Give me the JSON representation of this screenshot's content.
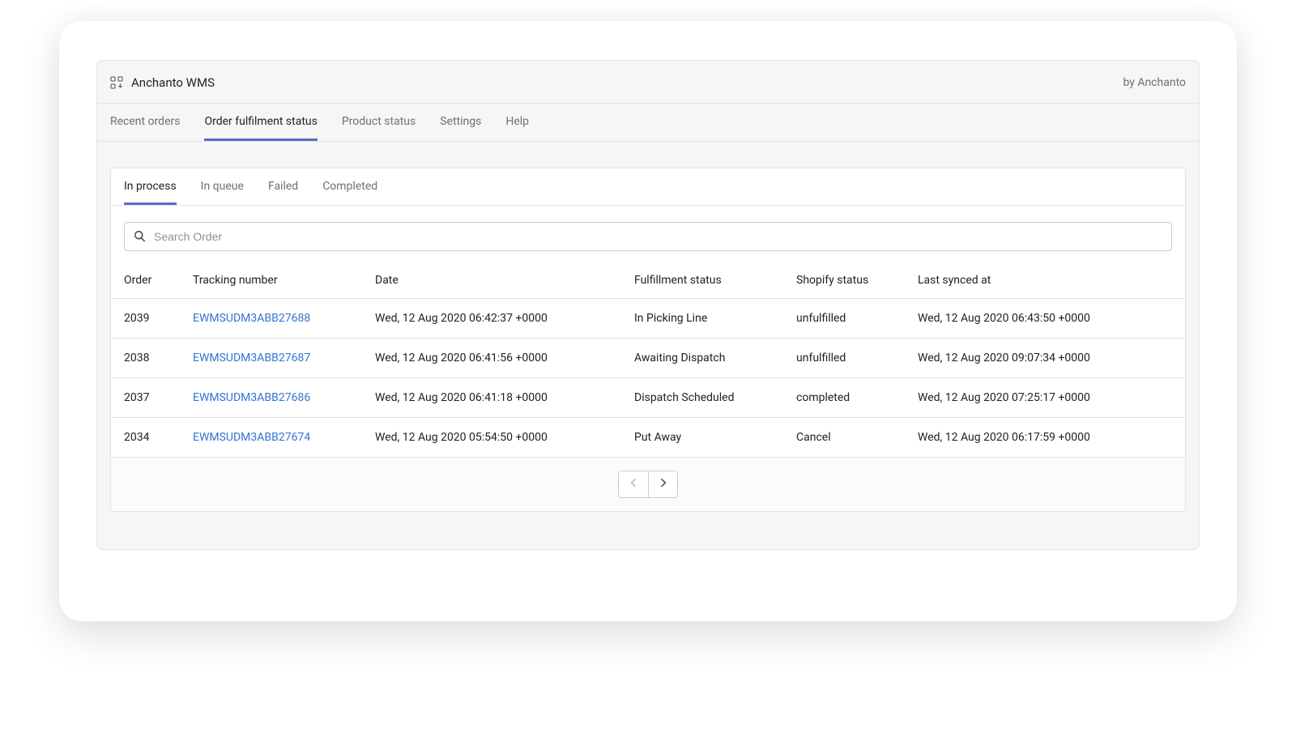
{
  "header": {
    "app_title": "Anchanto WMS",
    "by_text": "by Anchanto"
  },
  "nav_tabs": {
    "items": [
      {
        "label": "Recent orders"
      },
      {
        "label": "Order fulfilment status"
      },
      {
        "label": "Product status"
      },
      {
        "label": "Settings"
      },
      {
        "label": "Help"
      }
    ],
    "active_index": 1
  },
  "sub_tabs": {
    "items": [
      {
        "label": "In process"
      },
      {
        "label": "In queue"
      },
      {
        "label": "Failed"
      },
      {
        "label": "Completed"
      }
    ],
    "active_index": 0
  },
  "search": {
    "placeholder": "Search Order",
    "value": ""
  },
  "table": {
    "columns": [
      {
        "label": "Order"
      },
      {
        "label": "Tracking number"
      },
      {
        "label": "Date"
      },
      {
        "label": "Fulfillment status"
      },
      {
        "label": "Shopify status"
      },
      {
        "label": "Last synced at"
      }
    ],
    "rows": [
      {
        "order": "2039",
        "tracking": "EWMSUDM3ABB27688",
        "date": "Wed, 12 Aug 2020 06:42:37 +0000",
        "fulfillment": "In Picking Line",
        "shopify": "unfulfilled",
        "synced": "Wed, 12 Aug 2020 06:43:50 +0000"
      },
      {
        "order": "2038",
        "tracking": "EWMSUDM3ABB27687",
        "date": "Wed, 12 Aug 2020 06:41:56 +0000",
        "fulfillment": "Awaiting Dispatch",
        "shopify": "unfulfilled",
        "synced": "Wed, 12 Aug 2020 09:07:34 +0000"
      },
      {
        "order": "2037",
        "tracking": "EWMSUDM3ABB27686",
        "date": "Wed, 12 Aug 2020 06:41:18 +0000",
        "fulfillment": "Dispatch Scheduled",
        "shopify": "completed",
        "synced": "Wed, 12 Aug 2020 07:25:17 +0000"
      },
      {
        "order": "2034",
        "tracking": "EWMSUDM3ABB27674",
        "date": "Wed, 12 Aug 2020 05:54:50 +0000",
        "fulfillment": "Put Away",
        "shopify": "Cancel",
        "synced": "Wed, 12 Aug 2020 06:17:59 +0000"
      }
    ]
  }
}
